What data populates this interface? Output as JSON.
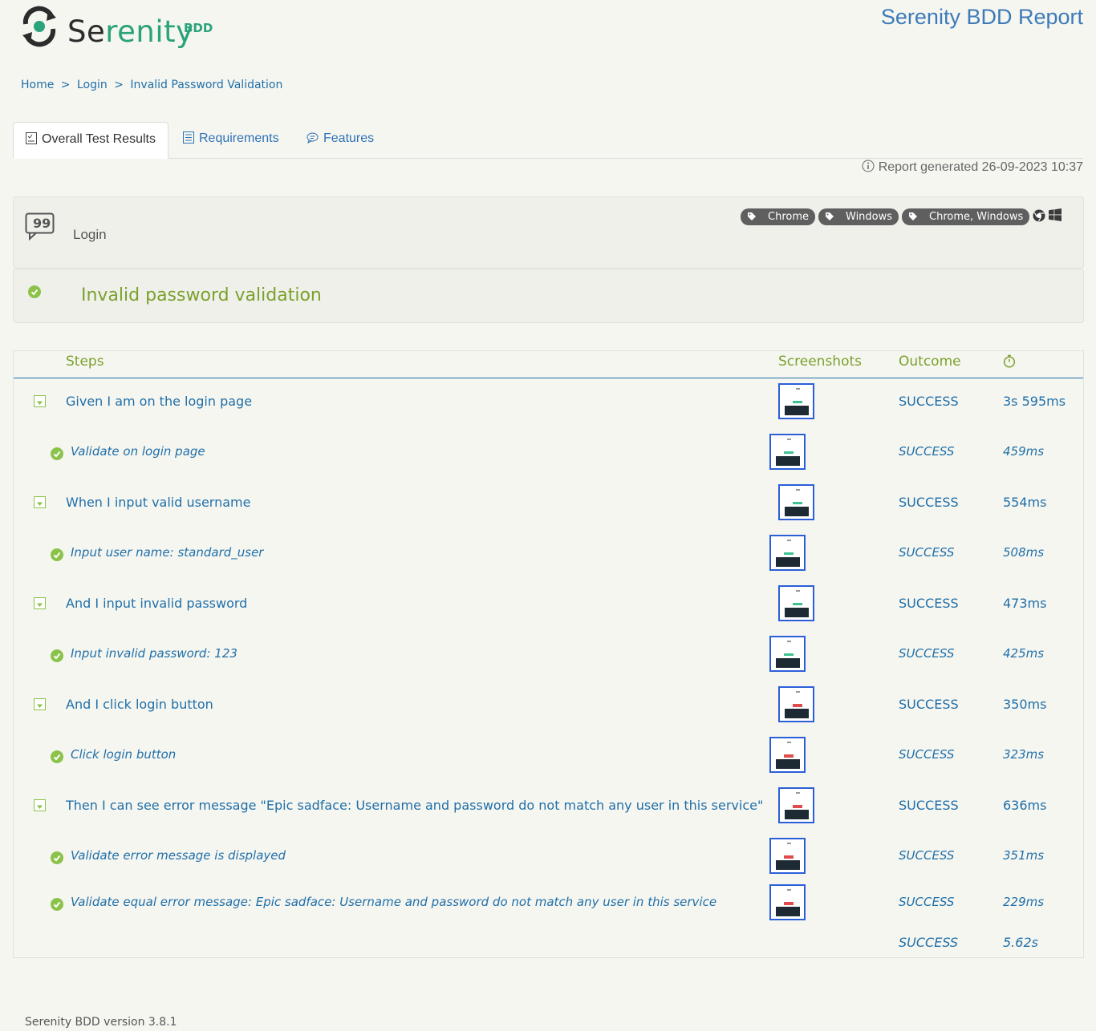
{
  "header": {
    "logo_word_prefix": "Se",
    "logo_word_rest": "renity",
    "logo_badge": "BDD",
    "report_title": "Serenity BDD Report"
  },
  "breadcrumb": {
    "home": "Home",
    "login": "Login",
    "current": "Invalid Password Validation",
    "separator": ">"
  },
  "tabs": [
    {
      "label": "Overall Test Results",
      "icon": "checklist-icon"
    },
    {
      "label": "Requirements",
      "icon": "list-icon"
    },
    {
      "label": "Features",
      "icon": "comment-icon"
    }
  ],
  "report_generated": "Report generated 26-09-2023 10:37",
  "feature": {
    "name": "Login",
    "icon": "quote-bubble-icon"
  },
  "tags": [
    "Chrome",
    "Windows",
    "Chrome, Windows"
  ],
  "scenario": {
    "title": "Invalid password validation"
  },
  "steps_header": {
    "steps": "Steps",
    "screenshots": "Screenshots",
    "outcome": "Outcome",
    "duration_icon": "stopwatch-icon"
  },
  "steps": [
    {
      "text": "Given I am on the login page",
      "outcome": "SUCCESS",
      "duration": "3s 595ms",
      "sub": false,
      "shot": "green"
    },
    {
      "text": "Validate on login page",
      "outcome": "SUCCESS",
      "duration": "459ms",
      "sub": true,
      "shot": "green"
    },
    {
      "text": "When I input valid username",
      "outcome": "SUCCESS",
      "duration": "554ms",
      "sub": false,
      "shot": "green"
    },
    {
      "text": "Input user name: standard_user",
      "outcome": "SUCCESS",
      "duration": "508ms",
      "sub": true,
      "shot": "green"
    },
    {
      "text": "And I input invalid password",
      "outcome": "SUCCESS",
      "duration": "473ms",
      "sub": false,
      "shot": "green"
    },
    {
      "text": "Input invalid password: 123",
      "outcome": "SUCCESS",
      "duration": "425ms",
      "sub": true,
      "shot": "green"
    },
    {
      "text": "And I click login button",
      "outcome": "SUCCESS",
      "duration": "350ms",
      "sub": false,
      "shot": "red"
    },
    {
      "text": "Click login button",
      "outcome": "SUCCESS",
      "duration": "323ms",
      "sub": true,
      "shot": "red"
    },
    {
      "text": "Then I can see error message \"Epic sadface: Username and password do not match any user in this service\"",
      "outcome": "SUCCESS",
      "duration": "636ms",
      "sub": false,
      "shot": "red"
    },
    {
      "text": "Validate error message is displayed",
      "outcome": "SUCCESS",
      "duration": "351ms",
      "sub": true,
      "shot": "red"
    },
    {
      "text": "Validate equal error message: Epic sadface: Username and password do not match any user in this service",
      "outcome": "SUCCESS",
      "duration": "229ms",
      "sub": true,
      "shot": "red"
    }
  ],
  "total": {
    "outcome": "SUCCESS",
    "duration": "5.62s"
  },
  "footer": "Serenity BDD version 3.8.1",
  "colors": {
    "accent_green": "#7ba12c",
    "link_blue": "#1f6fa8",
    "success_check": "#8bc34a",
    "brand": "#2aa27a"
  }
}
